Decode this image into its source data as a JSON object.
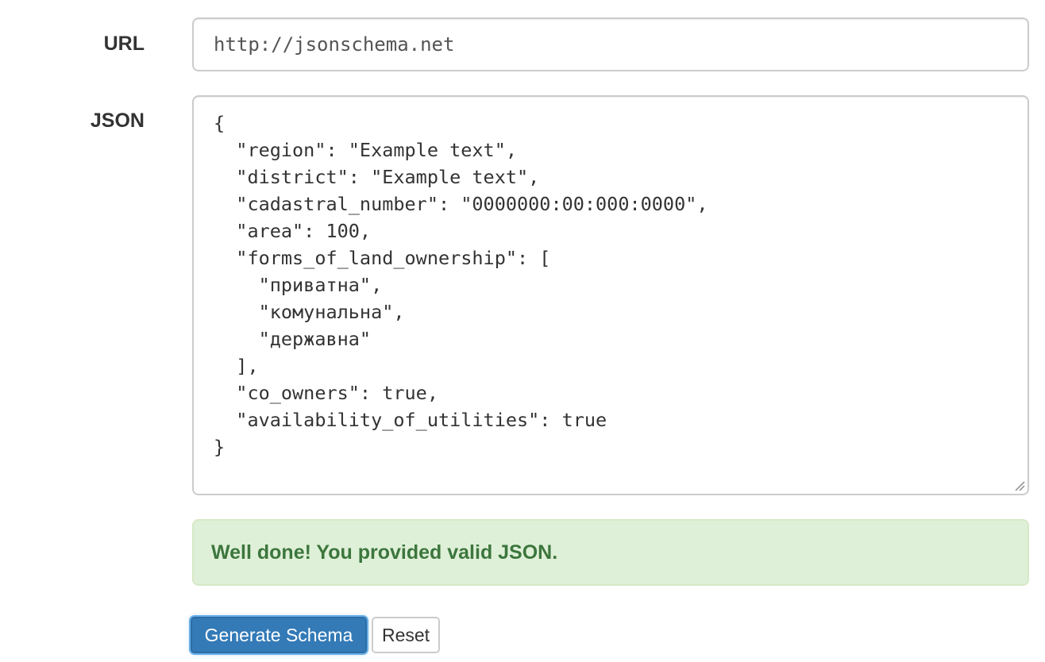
{
  "form": {
    "url_label": "URL",
    "url_value": "http://jsonschema.net",
    "json_label": "JSON",
    "json_value": "{\n  \"region\": \"Example text\",\n  \"district\": \"Example text\",\n  \"cadastral_number\": \"0000000:00:000:0000\",\n  \"area\": 100,\n  \"forms_of_land_ownership\": [\n    \"приватна\",\n    \"комунальна\",\n    \"державна\"\n  ],\n  \"co_owners\": true,\n  \"availability_of_utilities\": true\n}"
  },
  "alert": {
    "message": "Well done! You provided valid JSON.",
    "color": "#3c763d",
    "background": "#dff0d8"
  },
  "actions": {
    "generate_label": "Generate Schema",
    "reset_label": "Reset",
    "primary_color": "#337ab7"
  }
}
